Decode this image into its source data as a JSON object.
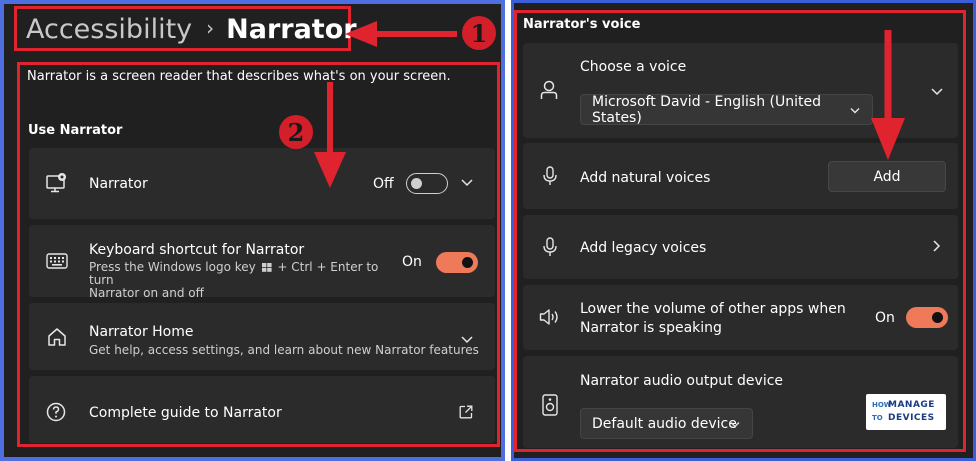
{
  "breadcrumb": {
    "parent": "Accessibility",
    "separator": "›",
    "current": "Narrator"
  },
  "left": {
    "description": "Narrator is a screen reader that describes what's on your screen.",
    "section_title": "Use Narrator",
    "cards": {
      "narrator": {
        "title": "Narrator",
        "state": "Off",
        "icon": "narrator-monitor-icon"
      },
      "shortcut": {
        "title": "Keyboard shortcut for Narrator",
        "sub_a": "Press the Windows logo key",
        "sub_b": "+ Ctrl + Enter to turn",
        "sub_c": "Narrator on and off",
        "state": "On",
        "icon": "keyboard-icon"
      },
      "home": {
        "title": "Narrator Home",
        "sub": "Get help, access settings, and learn about new Narrator features",
        "icon": "home-icon"
      },
      "guide": {
        "title": "Complete guide to Narrator",
        "icon": "help-circle-icon",
        "link_icon": "open-external-icon"
      }
    }
  },
  "right": {
    "section_title": "Narrator's voice",
    "choose_voice": {
      "title": "Choose a voice",
      "selected": "Microsoft David - English (United States)",
      "icon": "person-icon"
    },
    "natural_voices": {
      "title": "Add natural voices",
      "button": "Add",
      "icon": "microphone-icon"
    },
    "legacy_voices": {
      "title": "Add legacy voices",
      "icon": "microphone-icon"
    },
    "lower_volume": {
      "title_line1": "Lower the volume of other apps when",
      "title_line2": "Narrator is speaking",
      "state": "On",
      "icon": "speaker-icon"
    },
    "output_device": {
      "title": "Narrator audio output device",
      "selected": "Default audio device",
      "icon": "audio-device-icon"
    }
  },
  "annotations": {
    "badge1": "1",
    "badge2": "2"
  },
  "logo": {
    "line1": "HOW",
    "line2": "MANAGE",
    "line3": "TO",
    "line4": "DEVICES"
  },
  "colors": {
    "accent": "#ee7a5a",
    "annotation_red": "#e0242f",
    "background": "#202020",
    "card": "#2b2b2b",
    "frame_blue": "#4f6fe0"
  }
}
